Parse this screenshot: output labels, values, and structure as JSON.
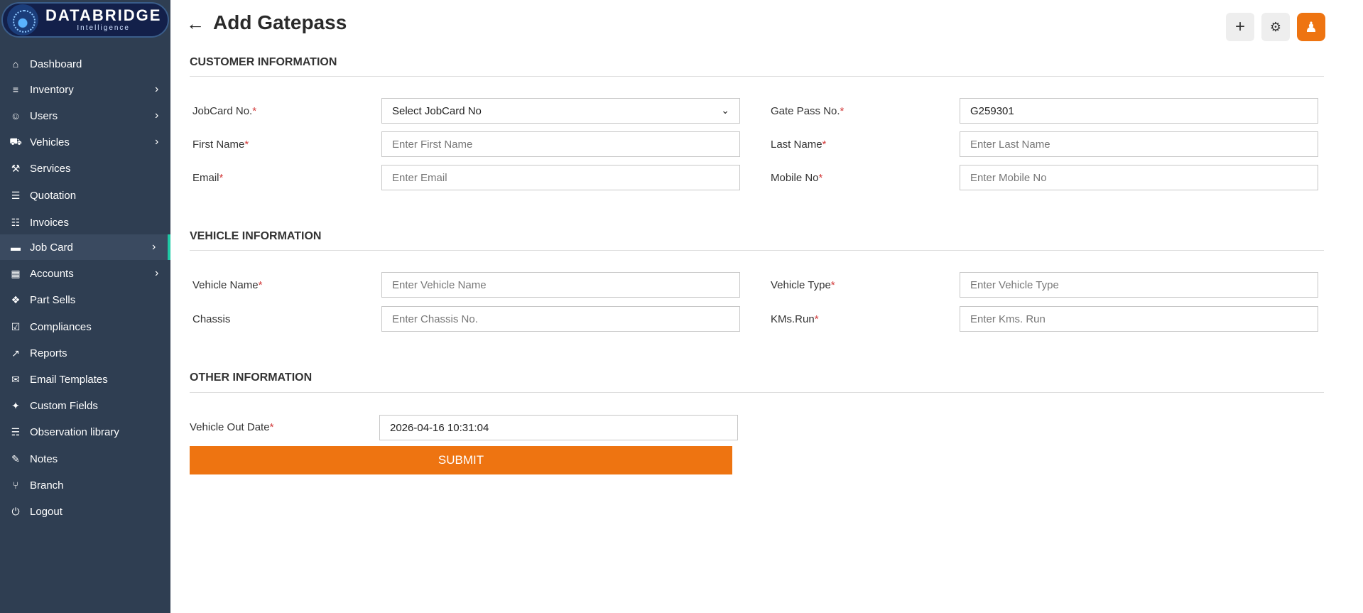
{
  "brand": {
    "title": "DATABRIDGE",
    "subtitle": "Intelligence"
  },
  "sidebar": {
    "items": [
      {
        "label": "Dashboard",
        "icon": "home-icon"
      },
      {
        "label": "Inventory",
        "icon": "sliders-icon",
        "has_children": true
      },
      {
        "label": "Users",
        "icon": "user-icon",
        "has_children": true
      },
      {
        "label": "Vehicles",
        "icon": "car-icon",
        "has_children": true
      },
      {
        "label": "Services",
        "icon": "wrench-icon"
      },
      {
        "label": "Quotation",
        "icon": "document-icon"
      },
      {
        "label": "Invoices",
        "icon": "receipt-icon"
      },
      {
        "label": "Job Card",
        "icon": "card-icon",
        "has_children": true,
        "active": true
      },
      {
        "label": "Accounts",
        "icon": "calculator-icon",
        "has_children": true
      },
      {
        "label": "Part Sells",
        "icon": "tag-icon"
      },
      {
        "label": "Compliances",
        "icon": "clipboard-icon"
      },
      {
        "label": "Reports",
        "icon": "chart-line-icon"
      },
      {
        "label": "Email Templates",
        "icon": "email-template-icon"
      },
      {
        "label": "Custom Fields",
        "icon": "puzzle-icon"
      },
      {
        "label": "Observation library",
        "icon": "file-icon"
      },
      {
        "label": "Notes",
        "icon": "edit-icon"
      },
      {
        "label": "Branch",
        "icon": "branch-icon"
      },
      {
        "label": "Logout",
        "icon": "power-icon"
      }
    ]
  },
  "header": {
    "title": "Add Gatepass"
  },
  "colors": {
    "accent": "#ee7411",
    "sidebar_bg": "#2f3e52",
    "active_indicator": "#1ec9a5",
    "required": "#d23b3b"
  },
  "sections": {
    "customer": "CUSTOMER INFORMATION",
    "vehicle": "VEHICLE INFORMATION",
    "other": "OTHER INFORMATION"
  },
  "form": {
    "jobcard": {
      "label": "JobCard No.",
      "value": "Select JobCard No"
    },
    "gatepass": {
      "label": "Gate Pass No.",
      "value": "G259301"
    },
    "first_name": {
      "label": "First Name",
      "placeholder": "Enter First Name"
    },
    "last_name": {
      "label": "Last Name",
      "placeholder": "Enter Last Name"
    },
    "email": {
      "label": "Email",
      "placeholder": "Enter Email"
    },
    "mobile": {
      "label": "Mobile No",
      "placeholder": "Enter Mobile No"
    },
    "vehicle_name": {
      "label": "Vehicle Name",
      "placeholder": "Enter Vehicle Name"
    },
    "vehicle_type": {
      "label": "Vehicle Type",
      "placeholder": "Enter Vehicle Type"
    },
    "chassis": {
      "label": "Chassis",
      "placeholder": "Enter Chassis No."
    },
    "kms_run": {
      "label": "KMs.Run",
      "placeholder": "Enter Kms. Run"
    },
    "out_date": {
      "label": "Vehicle Out Date",
      "value": "2026-04-16 10:31:04"
    },
    "submit": "SUBMIT"
  }
}
